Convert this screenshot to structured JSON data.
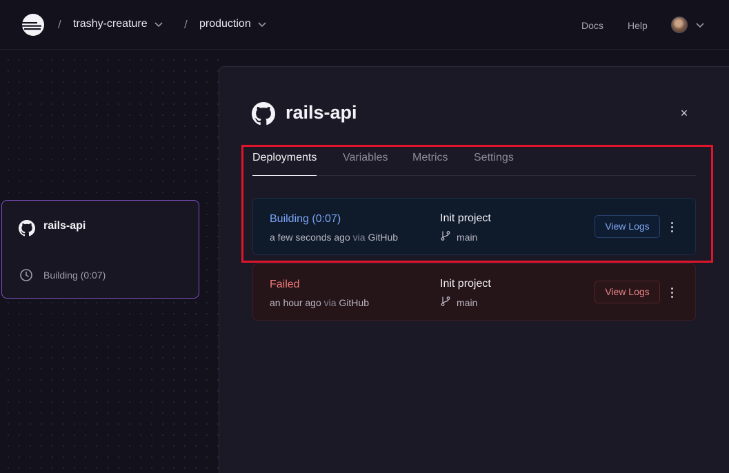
{
  "header": {
    "separator": "/",
    "breadcrumbs": [
      {
        "label": "trashy-creature"
      },
      {
        "label": "production"
      }
    ],
    "nav": {
      "docs": "Docs",
      "help": "Help"
    }
  },
  "canvas": {
    "service_card": {
      "icon": "github-icon",
      "name": "rails-api",
      "status": "Building (0:07)"
    }
  },
  "panel": {
    "title": "rails-api",
    "icon": "github-icon",
    "close": "×",
    "tabs": [
      {
        "label": "Deployments",
        "active": true
      },
      {
        "label": "Variables",
        "active": false
      },
      {
        "label": "Metrics",
        "active": false
      },
      {
        "label": "Settings",
        "active": false
      }
    ],
    "deployments": [
      {
        "status": "Building (0:07)",
        "time": "a few seconds ago",
        "via": "via",
        "source": "GitHub",
        "message": "Init project",
        "branch": "main",
        "logs_label": "View Logs"
      },
      {
        "status": "Failed",
        "time": "an hour ago",
        "via": "via",
        "source": "GitHub",
        "message": "Init project",
        "branch": "main",
        "logs_label": "View Logs"
      }
    ]
  },
  "colors": {
    "background": "#13111c",
    "panel": "#1b1925",
    "building": "#7aa5f5",
    "failed": "#f07a7a",
    "highlight": "#e0142a",
    "card_border": "#7e52c4"
  }
}
